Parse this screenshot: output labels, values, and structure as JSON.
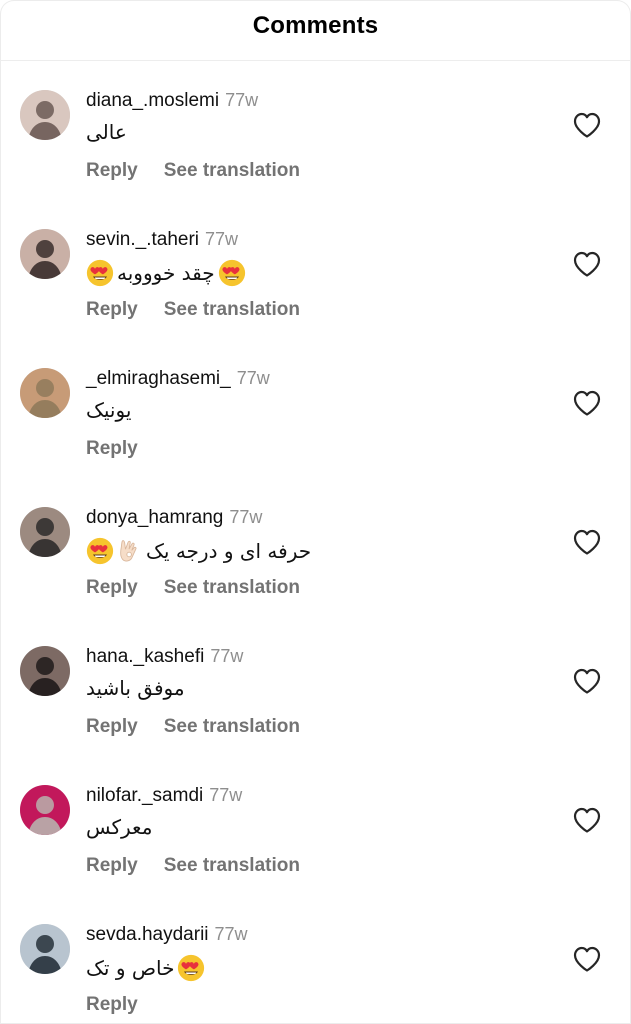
{
  "header": {
    "title": "Comments"
  },
  "comments": [
    {
      "username": "diana_.moslemi",
      "time": "77w",
      "text": "عالی",
      "emoji_before": [],
      "emoji_after": [],
      "reply_label": "Reply",
      "translation_label": "See translation",
      "show_translation": true,
      "avatar_colors": [
        "#6b5a55",
        "#d9c7bf"
      ]
    },
    {
      "username": "sevin._.taheri",
      "time": "77w",
      "text": "چقد خوووبه",
      "emoji_before": [
        "heart-eyes"
      ],
      "emoji_after": [
        "heart-eyes"
      ],
      "reply_label": "Reply",
      "translation_label": "See translation",
      "show_translation": true,
      "avatar_colors": [
        "#3a2e2c",
        "#c9b0a6"
      ]
    },
    {
      "username": "_elmiraghasemi_",
      "time": "77w",
      "text": "یونیک",
      "emoji_before": [],
      "emoji_after": [],
      "reply_label": "Reply",
      "translation_label": "",
      "show_translation": false,
      "avatar_colors": [
        "#8f7a5a",
        "#c79b77"
      ]
    },
    {
      "username": "donya_hamrang",
      "time": "77w",
      "text": "حرفه ای و درجه یک",
      "emoji_before": [],
      "emoji_after": [
        "ok-hand",
        "heart-eyes"
      ],
      "reply_label": "Reply",
      "translation_label": "See translation",
      "show_translation": true,
      "avatar_colors": [
        "#2d2a2a",
        "#9c8a80"
      ]
    },
    {
      "username": "hana._kashefi",
      "time": "77w",
      "text": "موفق باشید",
      "emoji_before": [],
      "emoji_after": [],
      "reply_label": "Reply",
      "translation_label": "See translation",
      "show_translation": true,
      "avatar_colors": [
        "#1f1a1a",
        "#7d6a64"
      ]
    },
    {
      "username": "nilofar._samdi",
      "time": "77w",
      "text": "معرکس",
      "emoji_before": [],
      "emoji_after": [],
      "reply_label": "Reply",
      "translation_label": "See translation",
      "show_translation": true,
      "avatar_colors": [
        "#b8b1ad",
        "#c2185b"
      ]
    },
    {
      "username": "sevda.haydarii",
      "time": "77w",
      "text": "خاص و تک",
      "emoji_before": [
        "heart-eyes"
      ],
      "emoji_after": [],
      "reply_label": "Reply",
      "translation_label": "",
      "show_translation": false,
      "avatar_colors": [
        "#26313a",
        "#b8c4cf"
      ]
    }
  ],
  "icons": {
    "like": "heart-outline-icon",
    "heart_eyes": "heart-eyes-emoji-icon",
    "ok_hand": "ok-hand-emoji-icon"
  },
  "colors": {
    "secondary_text": "#737373",
    "timestamp": "#8e8e8e",
    "emoji_face": "#f6c42d",
    "emoji_heart": "#e8313d"
  }
}
